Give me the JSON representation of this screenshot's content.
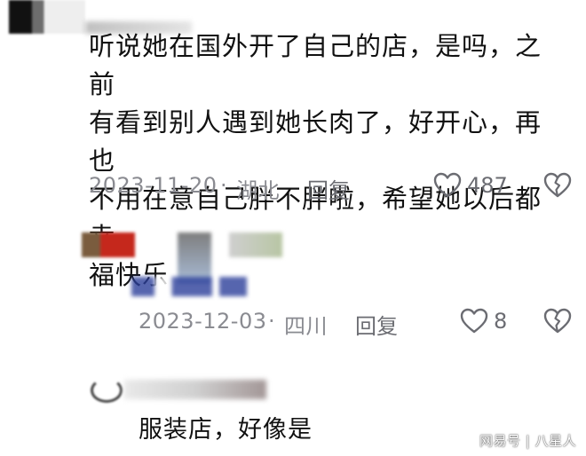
{
  "comment_main": {
    "lines": [
      "听说她在国外开了自己的店，是吗，之前",
      "有看到别人遇到她长肉了，好开心，再也",
      "不用在意自己胖不胖啦，希望她以后都幸",
      "福快乐"
    ],
    "date": "2023-11-20",
    "separator": "·",
    "location": "湖北",
    "reply_label": "回复",
    "like_count": "487"
  },
  "comment_reply": {
    "date": "2023-12-03",
    "separator": "·",
    "location": "四川",
    "reply_label": "回复",
    "like_count": "8"
  },
  "comment_third": {
    "text": "服装店，好像是"
  },
  "watermark": {
    "source": "网易号",
    "separator": "|",
    "author": "八星人"
  },
  "icons": {
    "like": "heart-outline-icon",
    "dislike": "broken-heart-icon"
  },
  "colors": {
    "text": "#161823",
    "meta": "#8a8b91",
    "icon": "#6b6c72"
  }
}
